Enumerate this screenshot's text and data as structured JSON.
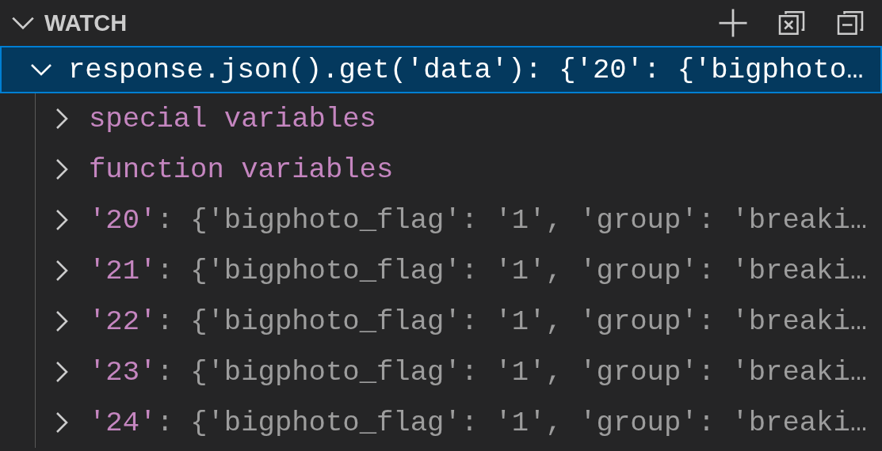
{
  "panel": {
    "title": "WATCH",
    "expanded": true
  },
  "watch": {
    "expression": "response.json().get('data')",
    "separator": ":",
    "value": "{'20': {'bigphoto…",
    "expanded": true,
    "selected": true,
    "children": [
      {
        "kind": "group",
        "label": "special variables",
        "expanded": false
      },
      {
        "kind": "group",
        "label": "function variables",
        "expanded": false
      },
      {
        "kind": "entry",
        "key": "'20'",
        "separator": ":",
        "value": "{'bigphoto_flag': '1', 'group': 'breaki…",
        "expanded": false
      },
      {
        "kind": "entry",
        "key": "'21'",
        "separator": ":",
        "value": "{'bigphoto_flag': '1', 'group': 'breaki…",
        "expanded": false
      },
      {
        "kind": "entry",
        "key": "'22'",
        "separator": ":",
        "value": "{'bigphoto_flag': '1', 'group': 'breaki…",
        "expanded": false
      },
      {
        "kind": "entry",
        "key": "'23'",
        "separator": ":",
        "value": "{'bigphoto_flag': '1', 'group': 'breaki…",
        "expanded": false
      },
      {
        "kind": "entry",
        "key": "'24'",
        "separator": ":",
        "value": "{'bigphoto_flag': '1', 'group': 'breaki…",
        "expanded": false
      }
    ]
  }
}
